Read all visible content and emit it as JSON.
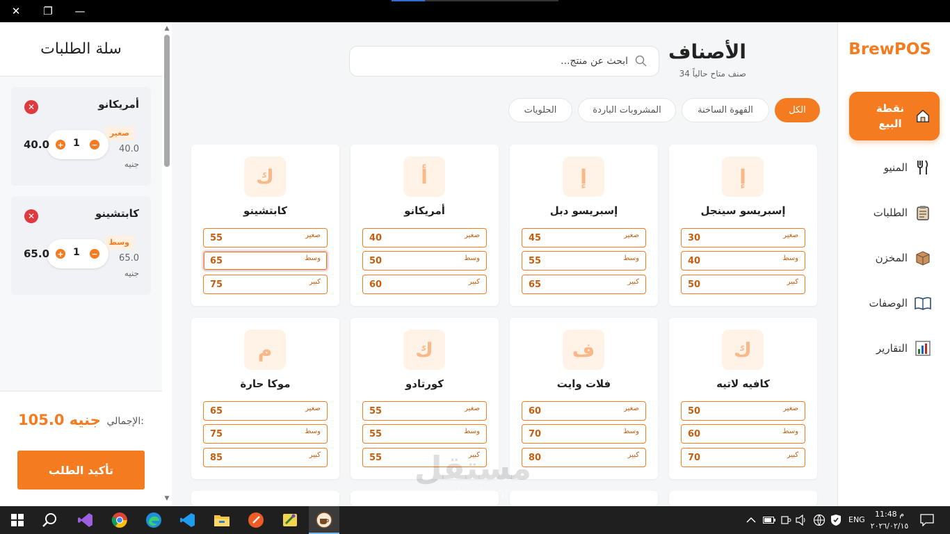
{
  "app": {
    "brand": "BrewPOS"
  },
  "nav": {
    "items": [
      {
        "label": "نقطة البيع",
        "icon": "home-icon",
        "active": true
      },
      {
        "label": "المنيو",
        "icon": "utensils-icon"
      },
      {
        "label": "الطلبات",
        "icon": "clipboard-icon"
      },
      {
        "label": "المخزن",
        "icon": "box-icon"
      },
      {
        "label": "الوصفات",
        "icon": "book-icon"
      },
      {
        "label": "التقارير",
        "icon": "bar-chart-icon"
      }
    ]
  },
  "main": {
    "title": "الأصناف",
    "subtitle": "34 صنف متاح حالياً",
    "search_placeholder": "ابحث عن منتج...",
    "filters": [
      "الكل",
      "القهوة الساخنة",
      "المشروبات الباردة",
      "الحلويات"
    ],
    "products": [
      {
        "name": "إسبريسو سينجل",
        "letter": "إ",
        "sizes": [
          {
            "label": "صغير",
            "price": "30"
          },
          {
            "label": "وسط",
            "price": "40"
          },
          {
            "label": "كبير",
            "price": "50"
          }
        ]
      },
      {
        "name": "إسبريسو دبل",
        "letter": "إ",
        "sizes": [
          {
            "label": "صغير",
            "price": "45"
          },
          {
            "label": "وسط",
            "price": "55"
          },
          {
            "label": "كبير",
            "price": "65"
          }
        ]
      },
      {
        "name": "أمريكانو",
        "letter": "أ",
        "sizes": [
          {
            "label": "صغير",
            "price": "40"
          },
          {
            "label": "وسط",
            "price": "50"
          },
          {
            "label": "كبير",
            "price": "60"
          }
        ]
      },
      {
        "name": "كابتشينو",
        "letter": "ك",
        "sizes": [
          {
            "label": "صغير",
            "price": "55"
          },
          {
            "label": "وسط",
            "price": "65"
          },
          {
            "label": "كبير",
            "price": "75"
          }
        ]
      },
      {
        "name": "كافيه لاتيه",
        "letter": "ك",
        "sizes": [
          {
            "label": "صغير",
            "price": "50"
          },
          {
            "label": "وسط",
            "price": "60"
          },
          {
            "label": "كبير",
            "price": "70"
          }
        ]
      },
      {
        "name": "فلات وايت",
        "letter": "ف",
        "sizes": [
          {
            "label": "صغير",
            "price": "60"
          },
          {
            "label": "وسط",
            "price": "70"
          },
          {
            "label": "كبير",
            "price": "80"
          }
        ]
      },
      {
        "name": "كورتادو",
        "letter": "ك",
        "sizes": [
          {
            "label": "صغير",
            "price": "55"
          },
          {
            "label": "وسط",
            "price": "55"
          },
          {
            "label": "كبير",
            "price": "55"
          }
        ]
      },
      {
        "name": "موكا حارة",
        "letter": "م",
        "sizes": [
          {
            "label": "صغير",
            "price": "65"
          },
          {
            "label": "وسط",
            "price": "75"
          },
          {
            "label": "كبير",
            "price": "85"
          }
        ]
      }
    ]
  },
  "cart": {
    "title": "سلة الطلبات",
    "items": [
      {
        "name": "أمريكانو",
        "size": "صغير",
        "unit_price": "40.0",
        "currency": "جنيه",
        "qty": "1",
        "line_total": "40.0"
      },
      {
        "name": "كابتشينو",
        "size": "وسط",
        "unit_price": "65.0",
        "currency": "جنيه",
        "qty": "1",
        "line_total": "65.0"
      }
    ],
    "total_label": "الإجمالي:",
    "total_value": "105.0 جنيه",
    "confirm_label": "تأكيد الطلب"
  },
  "taskbar": {
    "time": "11:48 م",
    "date": "٢٠٢٦/٠٢/١٥",
    "lang": "ENG"
  },
  "watermark": {
    "text": "مستقل",
    "url": "mostaql.com"
  },
  "colors": {
    "accent": "#f47b20",
    "danger": "#e03a3e"
  }
}
